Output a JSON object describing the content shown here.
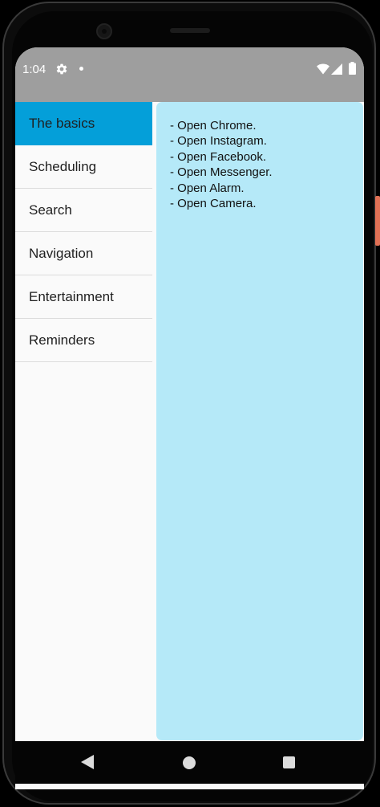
{
  "status_bar": {
    "time": "1:04",
    "icons": [
      "gear-icon",
      "dot-icon",
      "wifi-icon",
      "signal-icon",
      "battery-icon"
    ]
  },
  "colors": {
    "status_bar": "#9e9e9e",
    "selected_item": "#049fd9",
    "content_panel": "#b5e9f8",
    "sidebar": "#fafafa"
  },
  "sidebar": {
    "selected_index": 0,
    "items": [
      {
        "label": "The basics"
      },
      {
        "label": "Scheduling"
      },
      {
        "label": "Search"
      },
      {
        "label": "Navigation"
      },
      {
        "label": "Entertainment"
      },
      {
        "label": "Reminders"
      }
    ]
  },
  "content": {
    "lines": [
      "- Open Chrome.",
      "- Open Instagram.",
      "- Open Facebook.",
      "- Open Messenger.",
      "- Open Alarm.",
      "- Open Camera."
    ]
  },
  "nav_bar": {
    "icons": [
      "back-icon",
      "home-icon",
      "recents-icon"
    ]
  }
}
